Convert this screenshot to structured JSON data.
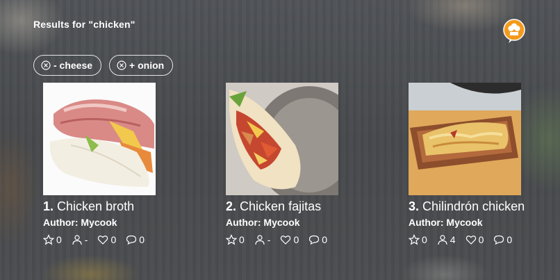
{
  "search": {
    "heading": "Results for \"chicken\""
  },
  "filters": [
    {
      "label": "- cheese",
      "icon": "close-circle-icon"
    },
    {
      "label": "+ onion",
      "icon": "close-circle-icon"
    }
  ],
  "results": [
    {
      "index": "1.",
      "title": "Chicken broth",
      "author": "Author: Mycook",
      "rating": "0",
      "servings": "-",
      "likes": "0",
      "comments": "0"
    },
    {
      "index": "2.",
      "title": "Chicken fajitas",
      "author": "Author: Mycook",
      "rating": "0",
      "servings": "-",
      "likes": "0",
      "comments": "0"
    },
    {
      "index": "3.",
      "title": "Chilindrón chicken",
      "author": "Author: Mycook",
      "rating": "0",
      "servings": "4",
      "likes": "0",
      "comments": "0"
    }
  ],
  "colors": {
    "accent": "#f39a1e",
    "text": "#ffffff",
    "background": "#4a4c4f"
  }
}
